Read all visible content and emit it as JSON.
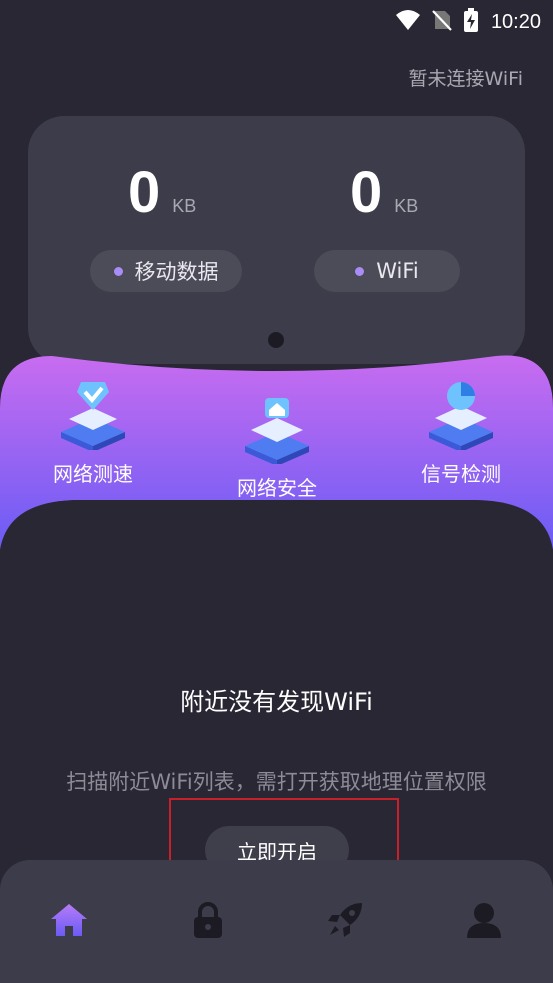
{
  "status_bar": {
    "time": "10:20"
  },
  "header": {
    "wifi_status": "暂未连接WiFi"
  },
  "usage_card": {
    "mobile": {
      "value": "0",
      "unit": "KB",
      "label": "移动数据"
    },
    "wifi": {
      "value": "0",
      "unit": "KB",
      "label": "WiFi"
    }
  },
  "features": [
    {
      "label": "网络测速",
      "icon": "speed-test-icon"
    },
    {
      "label": "网络安全",
      "icon": "network-security-icon"
    },
    {
      "label": "信号检测",
      "icon": "signal-detect-icon"
    }
  ],
  "empty_state": {
    "title": "附近没有发现WiFi",
    "description": "扫描附近WiFi列表，需打开获取地理位置权限",
    "button": "立即开启"
  },
  "bottom_nav": [
    {
      "icon": "home-icon",
      "active": true
    },
    {
      "icon": "lock-icon",
      "active": false
    },
    {
      "icon": "rocket-icon",
      "active": false
    },
    {
      "icon": "user-icon",
      "active": false
    }
  ],
  "colors": {
    "background": "#282733",
    "card": "#3d3c4a",
    "accent_purple": "#8a5cf6",
    "gradient_top": "#c86cf0",
    "gradient_bottom": "#6a5cf5",
    "highlight": "#c8202a"
  }
}
